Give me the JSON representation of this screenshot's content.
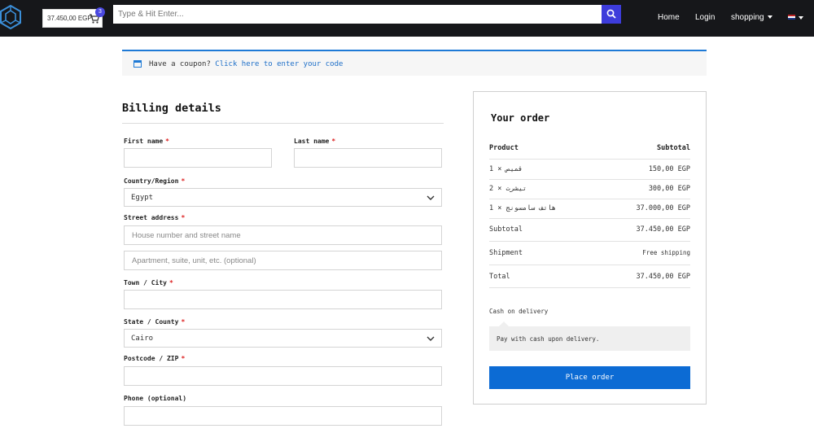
{
  "header": {
    "cart_total": "37.450,00 EGP",
    "cart_count": "3",
    "search_placeholder": "Type & Hit Enter...",
    "nav": {
      "home": "Home",
      "login": "Login",
      "shopping": "shopping"
    }
  },
  "coupon": {
    "text": "Have a coupon?",
    "link": "Click here to enter your code"
  },
  "billing": {
    "title": "Billing details",
    "first_name": "First name",
    "last_name": "Last name",
    "country": "Country/Region",
    "country_value": "Egypt",
    "street": "Street address",
    "street_placeholder": "House number and street name",
    "apartment_placeholder": "Apartment, suite, unit, etc. (optional)",
    "town": "Town / City",
    "state": "State / County",
    "state_value": "Cairo",
    "postcode": "Postcode / ZIP",
    "phone": "Phone (optional)",
    "required_mark": "*"
  },
  "order": {
    "title": "Your order",
    "col_product": "Product",
    "col_subtotal": "Subtotal",
    "items": [
      {
        "name": "قميص",
        "qty": "× 1",
        "price": "150,00 EGP"
      },
      {
        "name": "تيشرت",
        "qty": "× 2",
        "price": "300,00 EGP"
      },
      {
        "name": "هاتف سامسونج",
        "qty": "× 1",
        "price": "37.000,00 EGP"
      }
    ],
    "subtotal_label": "Subtotal",
    "subtotal_value": "37.450,00 EGP",
    "shipment_label": "Shipment",
    "shipment_value": "Free shipping",
    "total_label": "Total",
    "total_value": "37.450,00 EGP",
    "payment_method": "Cash on delivery",
    "payment_desc": "Pay with cash upon delivery.",
    "place_order": "Place order"
  },
  "colors": {
    "accent": "#0c6bd4",
    "header_bg": "#16171a",
    "search_button": "#3d3cdb"
  }
}
